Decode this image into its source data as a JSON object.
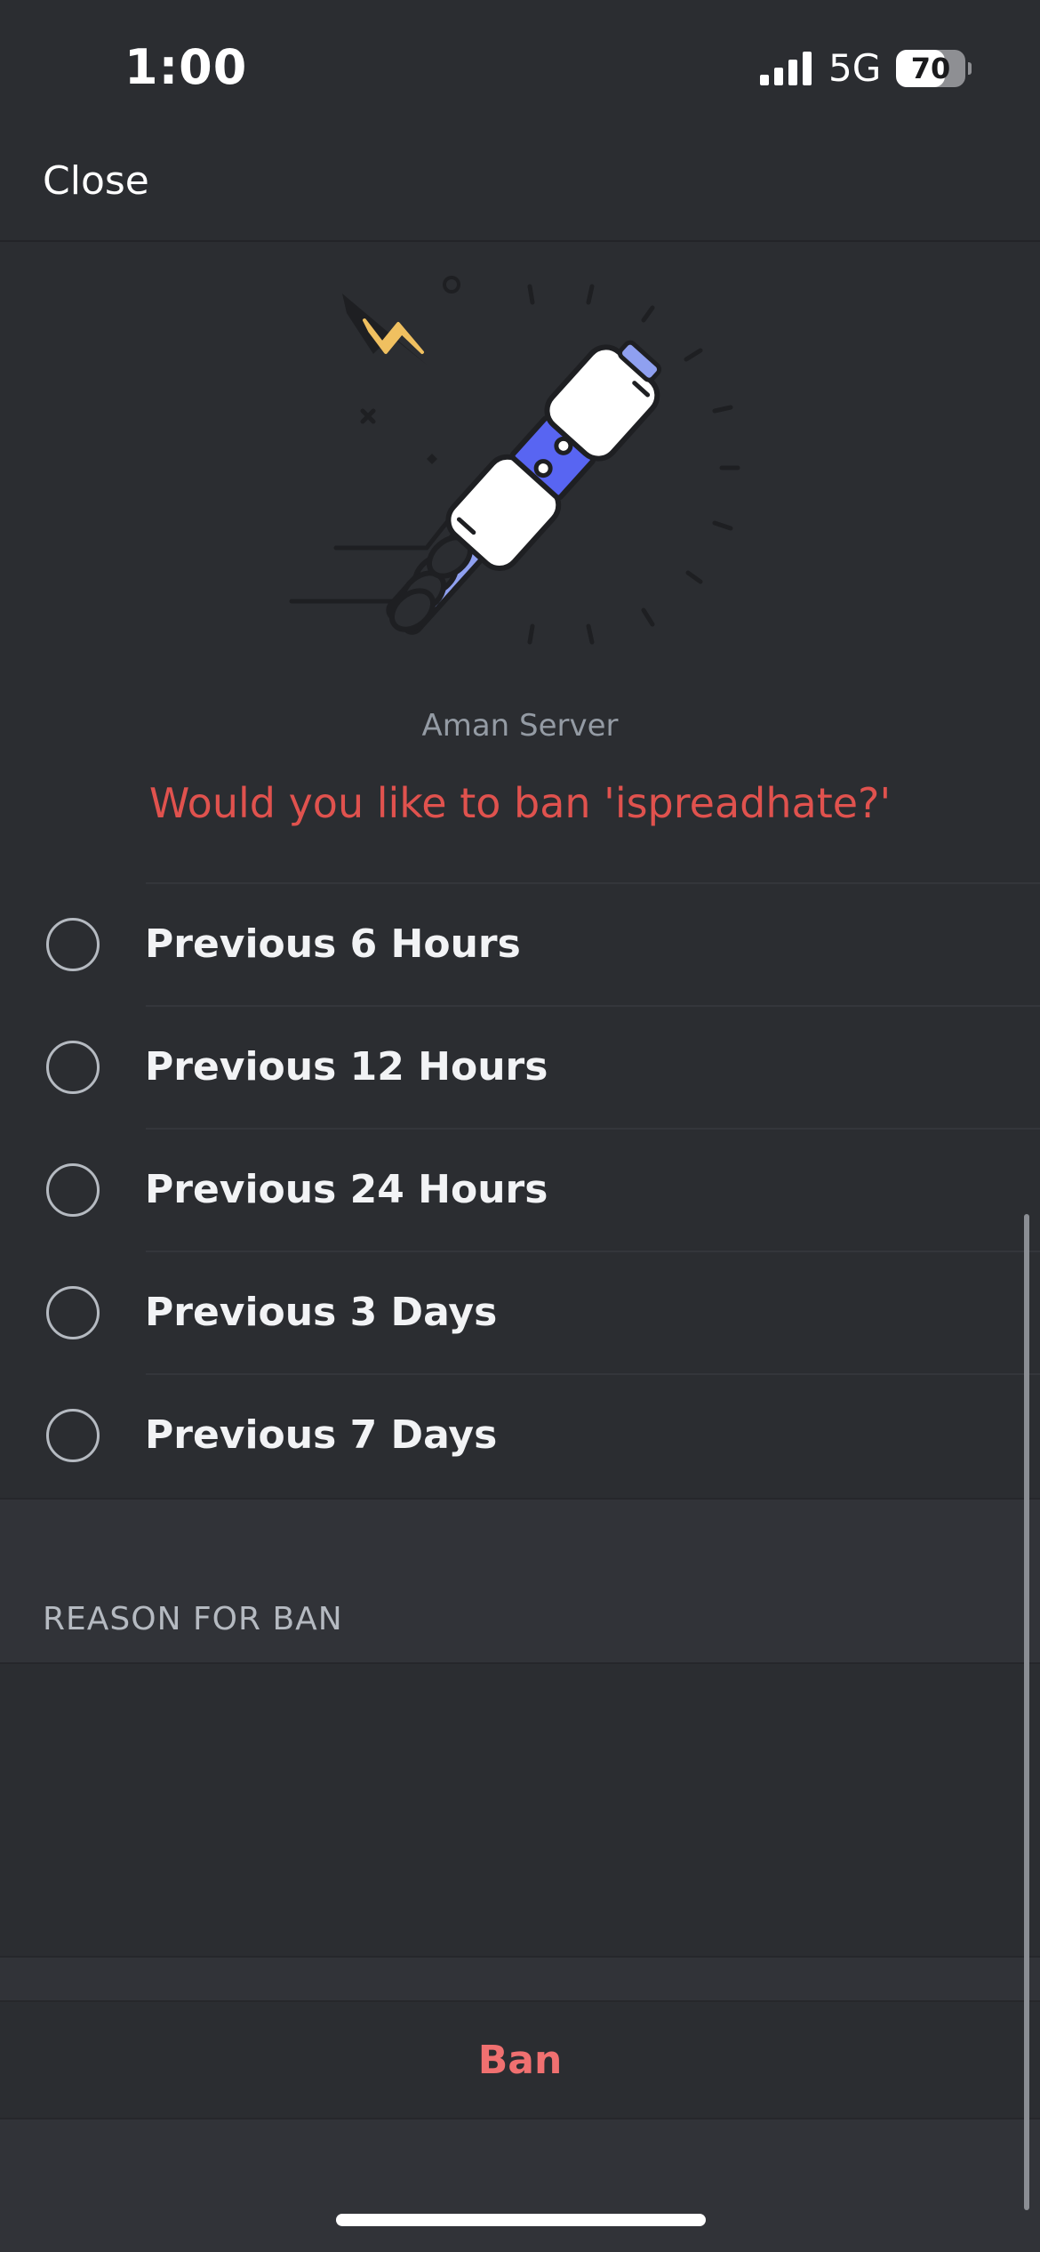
{
  "status_bar": {
    "time": "1:00",
    "network": "5G",
    "battery_percent": "70",
    "battery_level": 0.7
  },
  "header": {
    "close_label": "Close"
  },
  "hero": {
    "server_name": "Aman Server",
    "question": "Would you like to ban 'ispreadhate?'"
  },
  "delete_history_options": [
    {
      "label": "Previous 6 Hours",
      "selected": false
    },
    {
      "label": "Previous 12 Hours",
      "selected": false
    },
    {
      "label": "Previous 24 Hours",
      "selected": false
    },
    {
      "label": "Previous 3 Days",
      "selected": false
    },
    {
      "label": "Previous 7 Days",
      "selected": false
    }
  ],
  "reason": {
    "header": "REASON FOR BAN",
    "value": ""
  },
  "actions": {
    "ban_label": "Ban"
  },
  "colors": {
    "background": "#2b2d31",
    "danger": "#e0524e",
    "ban_text": "#f07070",
    "hammer_blue": "#5865f2",
    "bolt_yellow": "#f0c060"
  },
  "icons": [
    "signal-icon",
    "battery-icon",
    "ban-hammer-illustration",
    "lightning-icon"
  ]
}
